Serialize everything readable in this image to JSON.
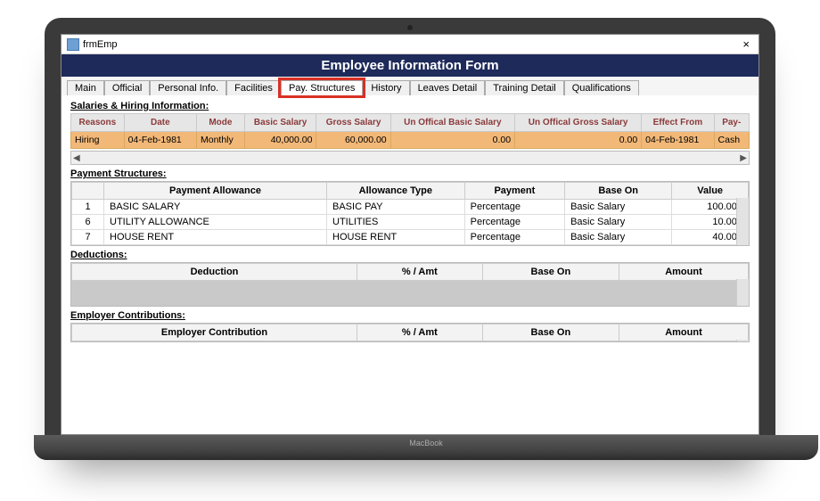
{
  "window": {
    "title": "frmEmp",
    "close": "×"
  },
  "header": "Employee Information Form",
  "tabs": [
    "Main",
    "Official",
    "Personal Info.",
    "Facilities",
    "Pay. Structures",
    "History",
    "Leaves Detail",
    "Training Detail",
    "Qualifications"
  ],
  "activeTabIndex": 4,
  "laptopLabel": "MacBook",
  "salaries": {
    "label": "Salaries & Hiring Information:",
    "columns": [
      "Reasons",
      "Date",
      "Mode",
      "Basic Salary",
      "Gross Salary",
      "Un Offical Basic Salary",
      "Un Offical Gross Salary",
      "Effect From",
      "Pay-"
    ],
    "rows": [
      {
        "reasons": "Hiring",
        "date": "04-Feb-1981",
        "mode": "Monthly",
        "basic": "40,000.00",
        "gross": "60,000.00",
        "unbasic": "0.00",
        "ungross": "0.00",
        "effect": "04-Feb-1981",
        "pay": "Cash"
      }
    ]
  },
  "paymentStructures": {
    "label": "Payment Structures:",
    "columns": [
      "",
      "Payment Allowance",
      "Allowance Type",
      "Payment",
      "Base On",
      "Value"
    ],
    "rows": [
      {
        "n": "1",
        "allow": "BASIC SALARY",
        "type": "BASIC PAY",
        "payment": "Percentage",
        "base": "Basic Salary",
        "value": "100.000"
      },
      {
        "n": "6",
        "allow": "UTILITY ALLOWANCE",
        "type": "UTILITIES",
        "payment": "Percentage",
        "base": "Basic Salary",
        "value": "10.000"
      },
      {
        "n": "7",
        "allow": "HOUSE RENT",
        "type": "HOUSE RENT",
        "payment": "Percentage",
        "base": "Basic Salary",
        "value": "40.000"
      }
    ]
  },
  "deductions": {
    "label": "Deductions:",
    "columns": [
      "Deduction",
      "% / Amt",
      "Base On",
      "Amount"
    ]
  },
  "employerContrib": {
    "label": "Employer Contributions:",
    "columns": [
      "Employer Contribution",
      "% / Amt",
      "Base On",
      "Amount"
    ]
  }
}
